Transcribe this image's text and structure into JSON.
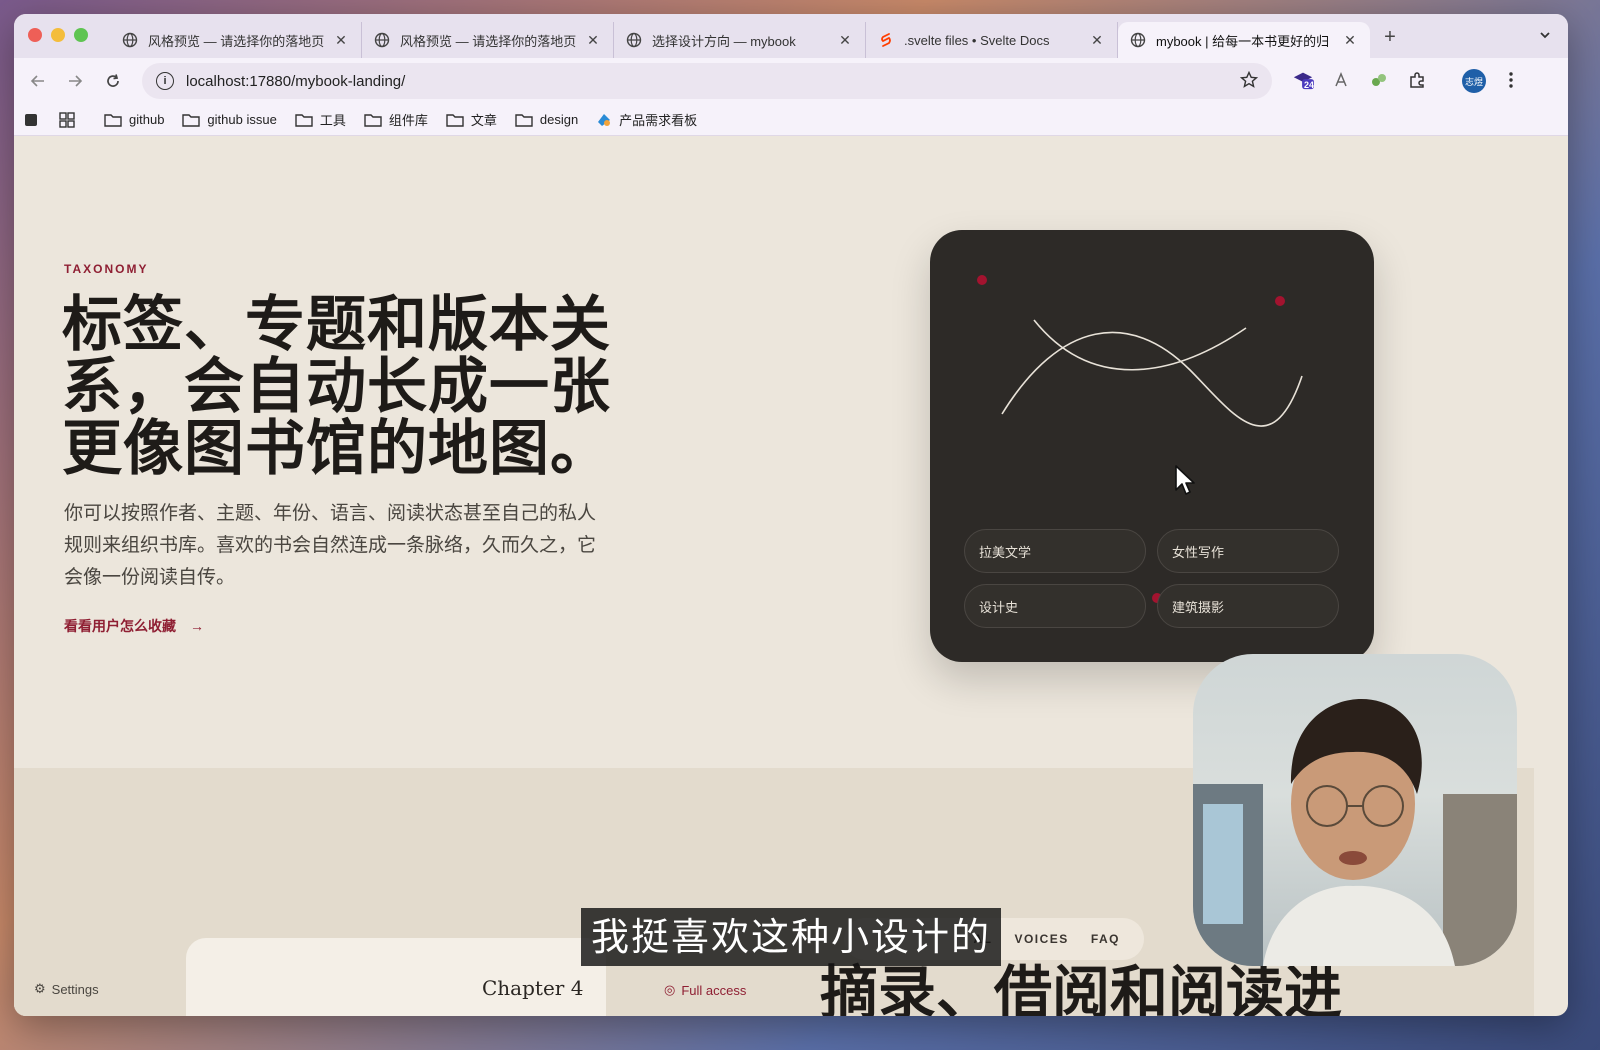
{
  "browser": {
    "tabs": [
      {
        "title": "风格预览 — 请选择你的落地页",
        "active": false
      },
      {
        "title": "风格预览 — 请选择你的落地页",
        "active": false
      },
      {
        "title": "选择设计方向 — mybook",
        "active": false
      },
      {
        "title": ".svelte files • Svelte Docs",
        "active": false
      },
      {
        "title": "mybook | 给每一本书更好的归",
        "active": true
      }
    ],
    "new_tab_label": "+",
    "close_label": "✕",
    "url": "localhost:17880/mybook-landing/",
    "extension_badge": "24",
    "profile_label": "志煜",
    "bookmarks": [
      {
        "label": "github",
        "icon": "folder-icon"
      },
      {
        "label": "github issue",
        "icon": "folder-icon"
      },
      {
        "label": "工具",
        "icon": "folder-icon"
      },
      {
        "label": "组件库",
        "icon": "folder-icon"
      },
      {
        "label": "文章",
        "icon": "folder-icon"
      },
      {
        "label": "design",
        "icon": "folder-icon"
      },
      {
        "label": "产品需求看板",
        "icon": "app-icon"
      }
    ]
  },
  "hero": {
    "eyebrow": "TAXONOMY",
    "headline_lines": [
      "标签、专题和版本关",
      "系，会自动长成一张",
      "更像图书馆的地图。"
    ],
    "description_lines": [
      "你可以按照作者、主题、年份、语言、阅读状态甚至自己的私人",
      "规则来组织书库。喜欢的书会自然连成一条脉络，久而久之，它",
      "会像一份阅读自传。"
    ],
    "cta_label": "看看用户怎么收藏",
    "cta_arrow": "→"
  },
  "card": {
    "chips": [
      "拉美文学",
      "女性写作",
      "设计史",
      "建筑摄影"
    ],
    "accent_color": "#a3132f"
  },
  "lower": {
    "subnav_items": [
      "AL",
      "VOICES",
      "FAQ"
    ],
    "ghost_title": "摘录、借阅和阅读进",
    "chapter_label": "Chapter 4",
    "full_access_label": "Full access",
    "settings_label": "Settings"
  },
  "video_subtitle": "我挺喜欢这种小设计的",
  "colors": {
    "accent": "#8f1f33",
    "page_bg": "#ece6dc",
    "card_bg": "#2d2a27"
  }
}
